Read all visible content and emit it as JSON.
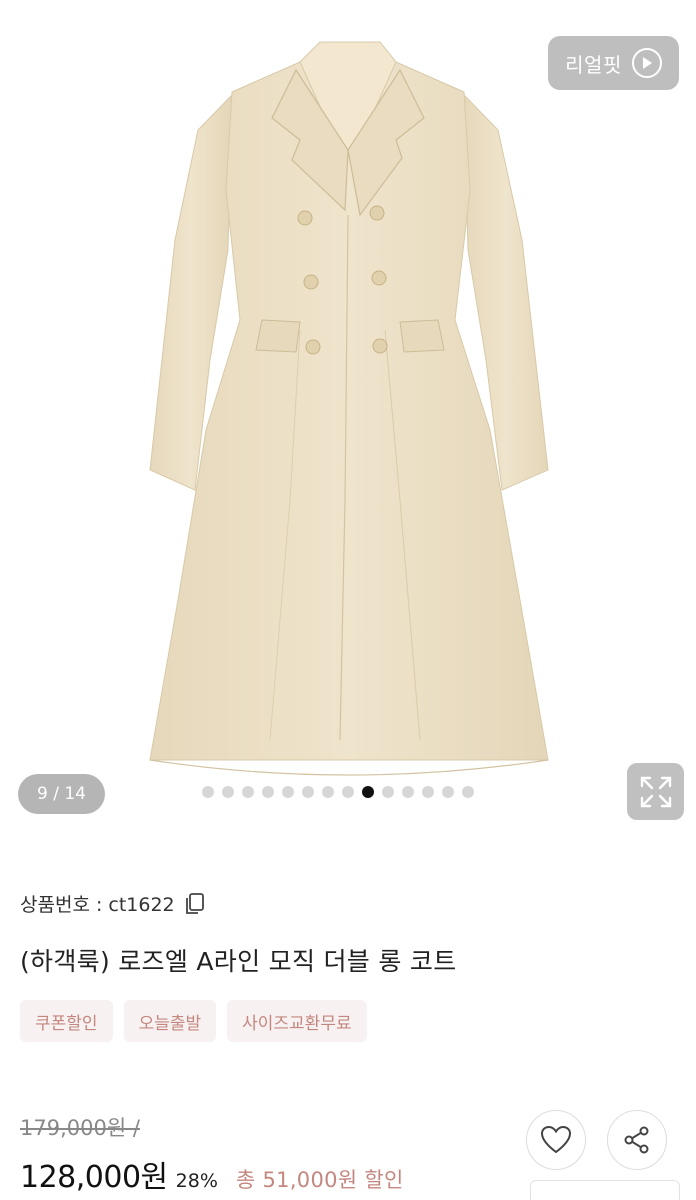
{
  "gallery": {
    "realfit_label": "리얼핏",
    "counter": "9 / 14",
    "total_images": 14,
    "current_index": 9
  },
  "product": {
    "code_label": "상품번호 : ct1622",
    "title": "(하객룩) 로즈엘 A라인 모직 더블 롱 코트",
    "badges": [
      "쿠폰할인",
      "오늘출발",
      "사이즈교환무료"
    ],
    "original_price": "179,000원 /",
    "sale_price": "128,000원",
    "discount_rate": "28%",
    "total_discount": "총 51,000원 할인"
  },
  "colors": {
    "accent": "#c4877f",
    "badge_bg": "#f7f1f1",
    "coat": "#ece0c6"
  }
}
